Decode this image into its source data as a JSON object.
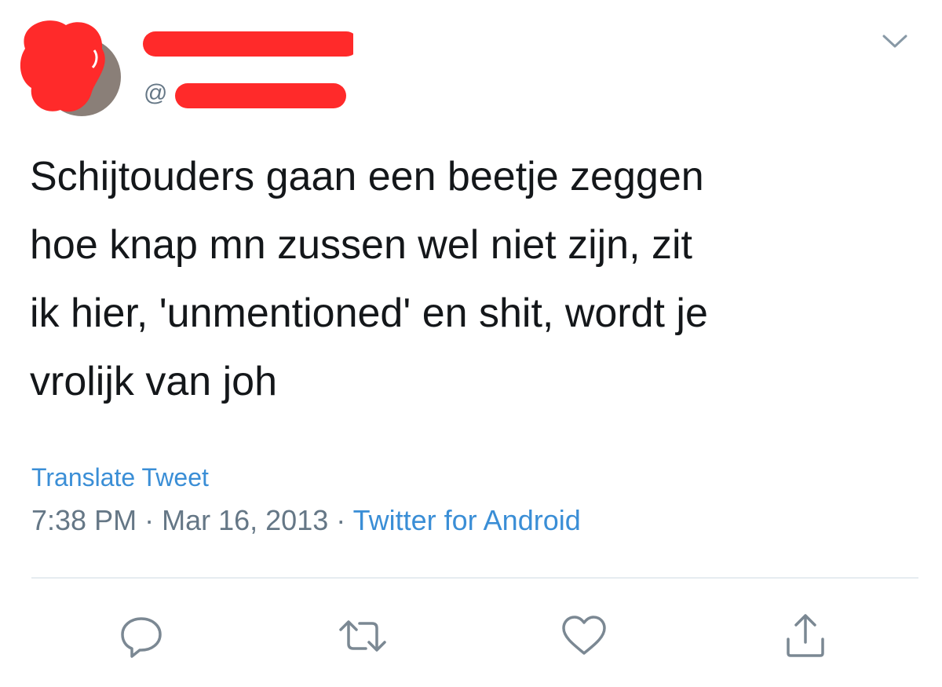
{
  "tweet": {
    "author": {
      "display_name": "",
      "handle_prefix": "@"
    },
    "text": "Schijtouders gaan een beetje zeggen\nhoe knap mn zussen wel niet zijn, zit\nik hier, 'unmentioned' en shit, wordt je\nvrolijk van joh",
    "translate_label": "Translate Tweet",
    "time": "7:38 PM",
    "separator": "·",
    "date": "Mar 16, 2013",
    "source": "Twitter for Android"
  },
  "icons": {
    "menu": "chevron-down-icon",
    "reply": "reply-icon",
    "retweet": "retweet-icon",
    "like": "heart-icon",
    "share": "share-icon"
  },
  "colors": {
    "link": "#3a8ed6",
    "muted": "#657786",
    "text": "#14171a",
    "redaction": "#ff2a2a",
    "icon": "#7b8893"
  }
}
